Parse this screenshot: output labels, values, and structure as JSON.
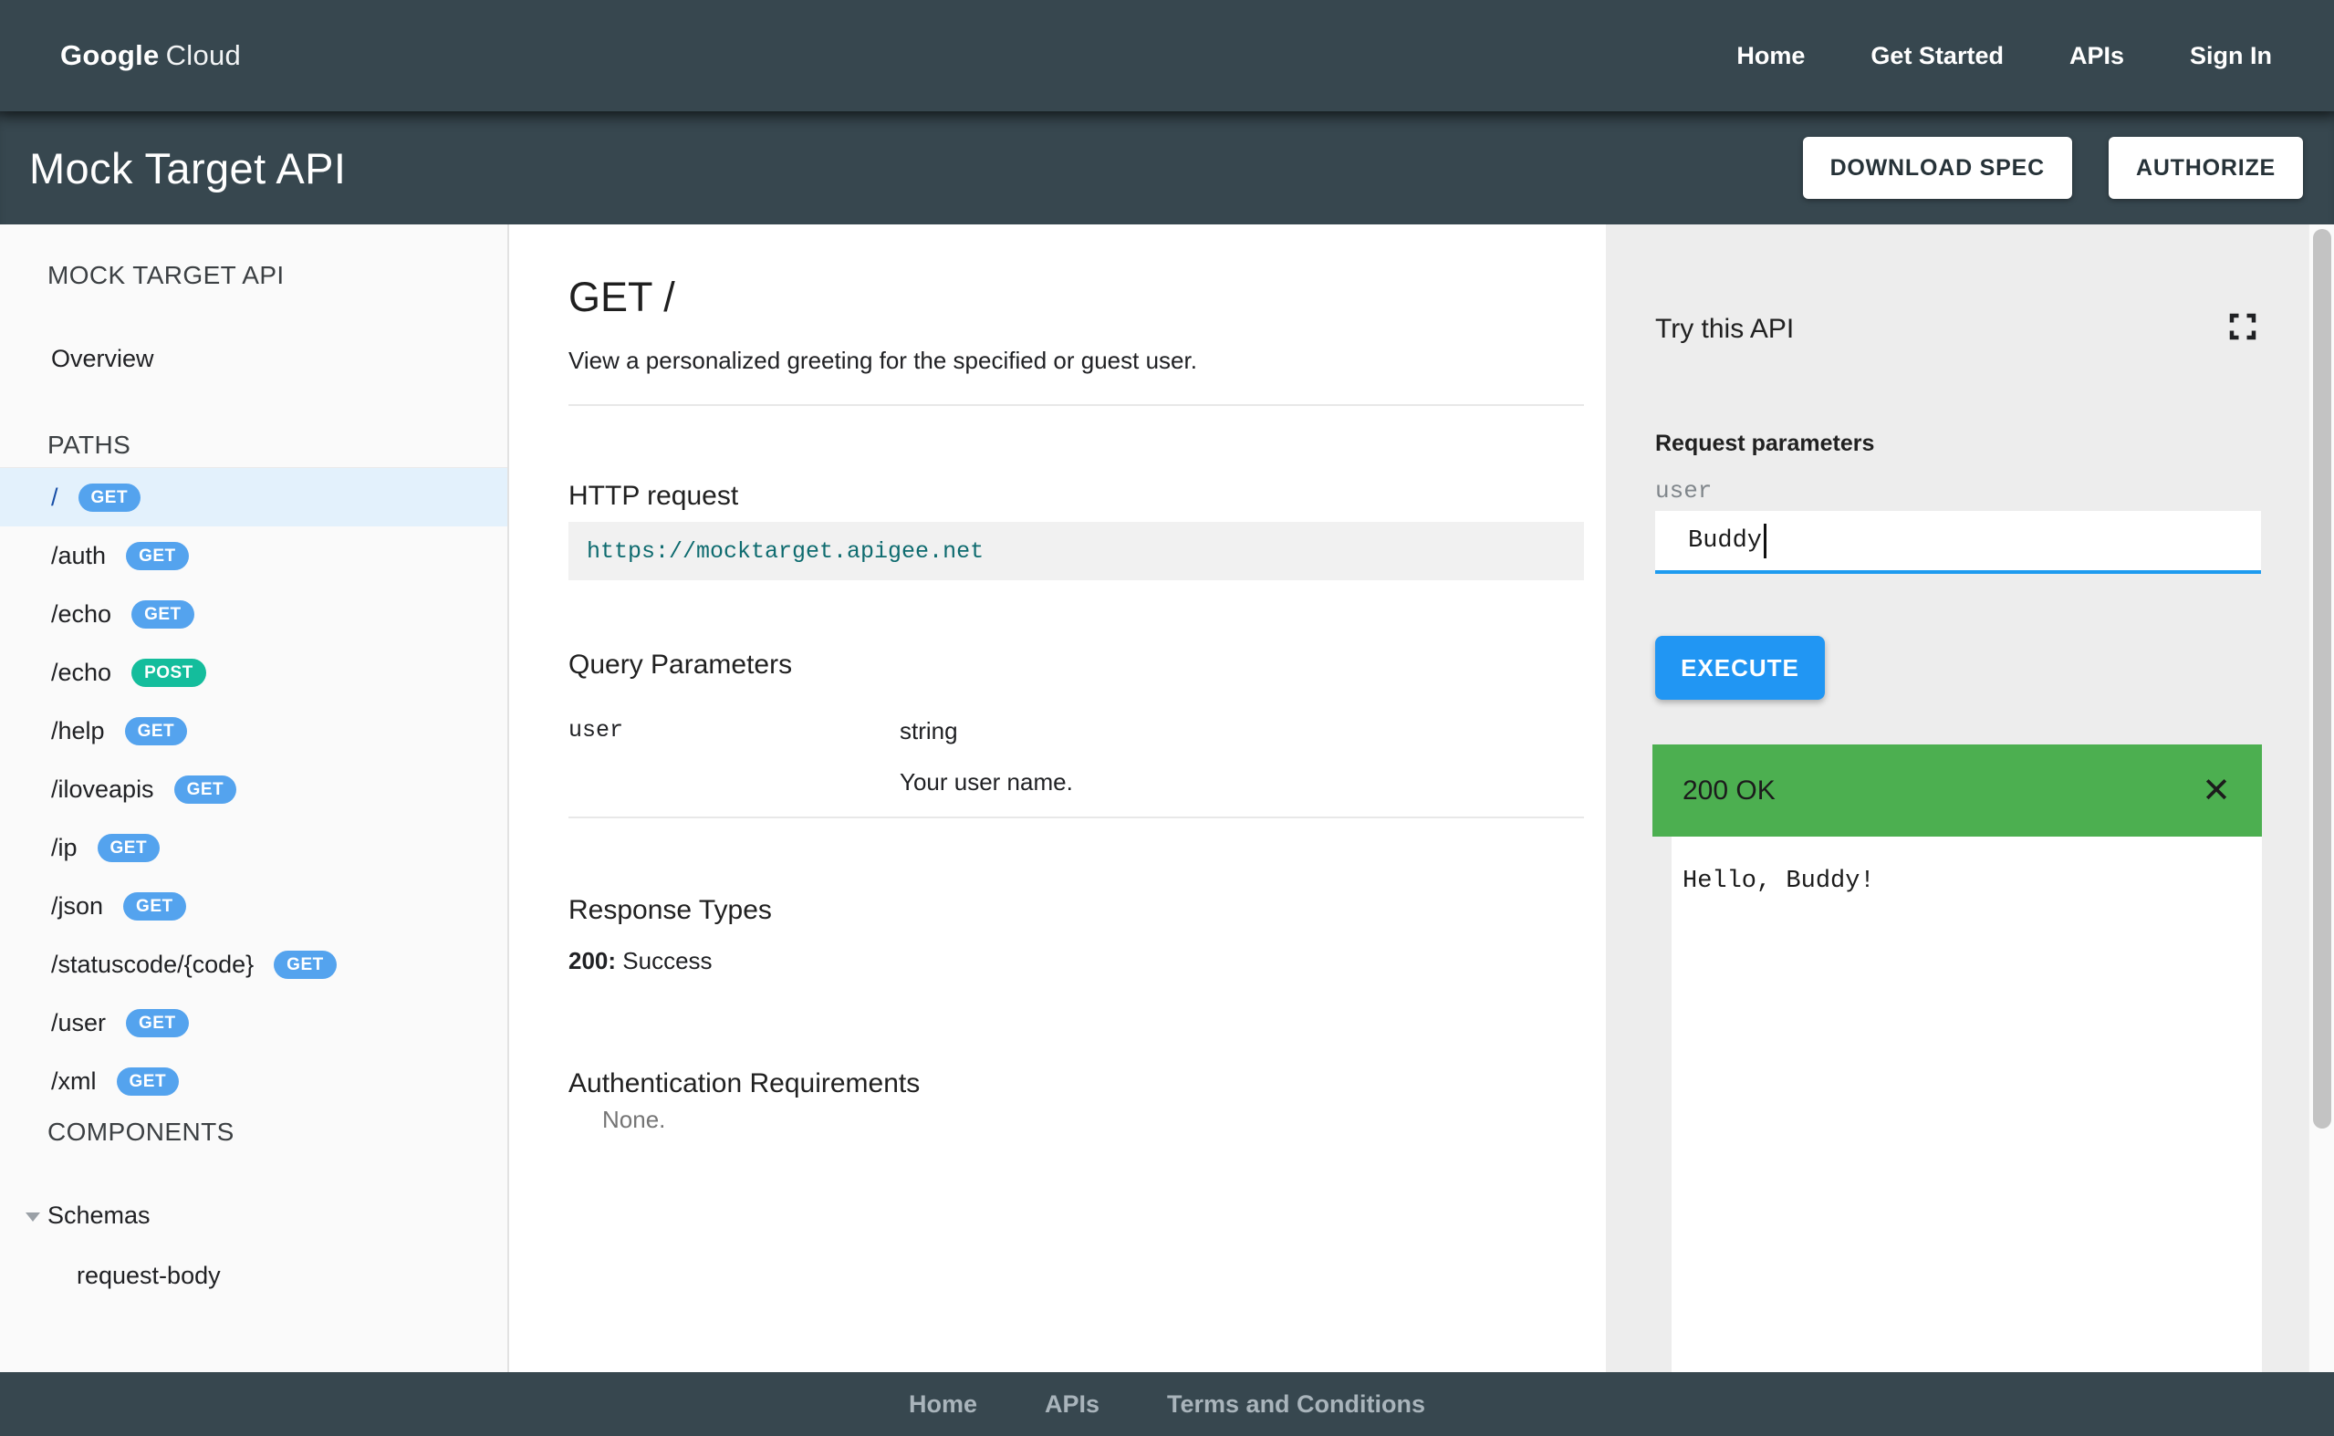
{
  "topnav": {
    "logo": {
      "google": "Google",
      "cloud": "Cloud"
    },
    "links": [
      "Home",
      "Get Started",
      "APIs",
      "Sign In"
    ]
  },
  "header": {
    "title": "Mock Target API",
    "download_spec_label": "DOWNLOAD SPEC",
    "authorize_label": "AUTHORIZE"
  },
  "sidebar": {
    "api_title": "MOCK TARGET API",
    "overview_label": "Overview",
    "paths_label": "PATHS",
    "paths": [
      {
        "path": "/",
        "method": "GET",
        "active": true
      },
      {
        "path": "/auth",
        "method": "GET",
        "active": false
      },
      {
        "path": "/echo",
        "method": "GET",
        "active": false
      },
      {
        "path": "/echo",
        "method": "POST",
        "active": false
      },
      {
        "path": "/help",
        "method": "GET",
        "active": false
      },
      {
        "path": "/iloveapis",
        "method": "GET",
        "active": false
      },
      {
        "path": "/ip",
        "method": "GET",
        "active": false
      },
      {
        "path": "/json",
        "method": "GET",
        "active": false
      },
      {
        "path": "/statuscode/{code}",
        "method": "GET",
        "active": false
      },
      {
        "path": "/user",
        "method": "GET",
        "active": false
      },
      {
        "path": "/xml",
        "method": "GET",
        "active": false
      }
    ],
    "components_label": "COMPONENTS",
    "schemas_label": "Schemas",
    "schema_items": [
      "request-body"
    ]
  },
  "main": {
    "title": "GET /",
    "description": "View a personalized greeting for the specified or guest user.",
    "http_request": {
      "heading": "HTTP request",
      "url": "https://mocktarget.apigee.net"
    },
    "query_parameters": {
      "heading": "Query Parameters",
      "params": [
        {
          "name": "user",
          "type": "string",
          "description": "Your user name."
        }
      ]
    },
    "response_types": {
      "heading": "Response Types",
      "code": "200:",
      "text": "Success"
    },
    "auth": {
      "heading": "Authentication Requirements",
      "value": "None."
    }
  },
  "try_panel": {
    "title": "Try this API",
    "request_parameters_label": "Request parameters",
    "param_label": "user",
    "param_value": "Buddy",
    "execute_label": "EXECUTE",
    "response_status": "200 OK",
    "close_icon": "✕",
    "response_body": "Hello, Buddy!"
  },
  "footer": {
    "links": [
      "Home",
      "APIs",
      "Terms and Conditions"
    ]
  },
  "colors": {
    "bar_dark": "#37474F",
    "accent_blue": "#2196F3",
    "get_badge": "#54A3EE",
    "post_badge": "#14BD9C",
    "success_green": "#4CAF50",
    "active_row": "#E3F1FC",
    "url_teal": "#0E6B6F"
  }
}
